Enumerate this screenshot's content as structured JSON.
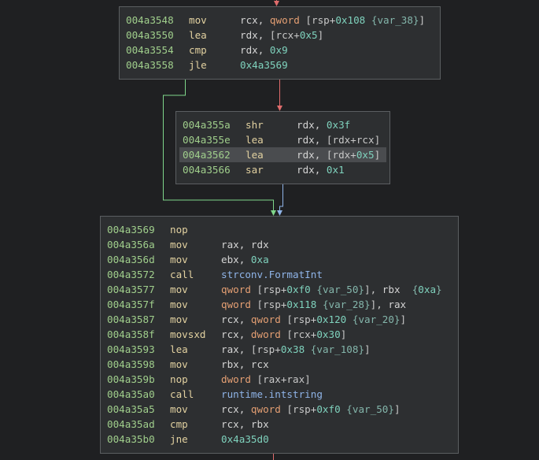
{
  "colors": {
    "background": "#1f2022",
    "block_bg": "#2d2f31",
    "block_border": "#5b5e61",
    "address": "#a0cf8c",
    "mnemonic": "#e2d1a0",
    "keyword": "#e49f73",
    "number": "#7fd2bd",
    "variable": "#84b6ab",
    "symbol": "#8fb4e8",
    "edge_true": "#7fd68a",
    "edge_false": "#e06c6c",
    "edge_unconditional": "#8fb4e8"
  },
  "blocks": [
    {
      "id": "block-004a3548",
      "lines": [
        {
          "addr": "004a3548",
          "mn": "mov",
          "ops": [
            [
              "reg",
              "rcx, "
            ],
            [
              "kw",
              "qword "
            ],
            [
              "punct",
              "[rsp+"
            ],
            [
              "num",
              "0x108"
            ],
            [
              "punct",
              " "
            ],
            [
              "var",
              "{var_38}"
            ],
            [
              "punct",
              "]"
            ]
          ]
        },
        {
          "addr": "004a3550",
          "mn": "lea",
          "ops": [
            [
              "reg",
              "rdx, "
            ],
            [
              "punct",
              "[rcx+"
            ],
            [
              "num",
              "0x5"
            ],
            [
              "punct",
              "]"
            ]
          ]
        },
        {
          "addr": "004a3554",
          "mn": "cmp",
          "ops": [
            [
              "reg",
              "rdx, "
            ],
            [
              "num",
              "0x9"
            ]
          ]
        },
        {
          "addr": "004a3558",
          "mn": "jle",
          "ops": [
            [
              "num",
              "0x4a3569"
            ]
          ]
        }
      ]
    },
    {
      "id": "block-004a355a",
      "lines": [
        {
          "addr": "004a355a",
          "mn": "shr",
          "ops": [
            [
              "reg",
              "rdx, "
            ],
            [
              "num",
              "0x3f"
            ]
          ]
        },
        {
          "addr": "004a355e",
          "mn": "lea",
          "ops": [
            [
              "reg",
              "rdx, "
            ],
            [
              "punct",
              "[rdx+rcx]"
            ]
          ]
        },
        {
          "addr": "004a3562",
          "mn": "lea",
          "ops": [
            [
              "reg",
              "rdx, "
            ],
            [
              "punct",
              "[rdx+"
            ],
            [
              "num",
              "0x5"
            ],
            [
              "punct",
              "]"
            ]
          ],
          "selected": true
        },
        {
          "addr": "004a3566",
          "mn": "sar",
          "ops": [
            [
              "reg",
              "rdx, "
            ],
            [
              "num",
              "0x1"
            ]
          ]
        }
      ]
    },
    {
      "id": "block-004a3569",
      "lines": [
        {
          "addr": "004a3569",
          "mn": "nop",
          "ops": []
        },
        {
          "addr": "004a356a",
          "mn": "mov",
          "ops": [
            [
              "reg",
              "rax, rdx"
            ]
          ]
        },
        {
          "addr": "004a356d",
          "mn": "mov",
          "ops": [
            [
              "reg",
              "ebx, "
            ],
            [
              "num",
              "0xa"
            ]
          ]
        },
        {
          "addr": "004a3572",
          "mn": "call",
          "ops": [
            [
              "sym",
              "strconv.FormatInt"
            ]
          ]
        },
        {
          "addr": "004a3577",
          "mn": "mov",
          "ops": [
            [
              "kw",
              "qword "
            ],
            [
              "punct",
              "[rsp+"
            ],
            [
              "num",
              "0xf0"
            ],
            [
              "punct",
              " "
            ],
            [
              "var",
              "{var_50}"
            ],
            [
              "punct",
              "], "
            ],
            [
              "reg",
              "rbx  "
            ],
            [
              "var",
              "{"
            ],
            [
              "num",
              "0xa"
            ],
            [
              "var",
              "}"
            ]
          ]
        },
        {
          "addr": "004a357f",
          "mn": "mov",
          "ops": [
            [
              "kw",
              "qword "
            ],
            [
              "punct",
              "[rsp+"
            ],
            [
              "num",
              "0x118"
            ],
            [
              "punct",
              " "
            ],
            [
              "var",
              "{var_28}"
            ],
            [
              "punct",
              "], "
            ],
            [
              "reg",
              "rax"
            ]
          ]
        },
        {
          "addr": "004a3587",
          "mn": "mov",
          "ops": [
            [
              "reg",
              "rcx, "
            ],
            [
              "kw",
              "qword "
            ],
            [
              "punct",
              "[rsp+"
            ],
            [
              "num",
              "0x120"
            ],
            [
              "punct",
              " "
            ],
            [
              "var",
              "{var_20}"
            ],
            [
              "punct",
              "]"
            ]
          ]
        },
        {
          "addr": "004a358f",
          "mn": "movsxd",
          "ops": [
            [
              "reg",
              "rcx, "
            ],
            [
              "kw",
              "dword "
            ],
            [
              "punct",
              "[rcx+"
            ],
            [
              "num",
              "0x30"
            ],
            [
              "punct",
              "]"
            ]
          ]
        },
        {
          "addr": "004a3593",
          "mn": "lea",
          "ops": [
            [
              "reg",
              "rax, "
            ],
            [
              "punct",
              "[rsp+"
            ],
            [
              "num",
              "0x38"
            ],
            [
              "punct",
              " "
            ],
            [
              "var",
              "{var_108}"
            ],
            [
              "punct",
              "]"
            ]
          ]
        },
        {
          "addr": "004a3598",
          "mn": "mov",
          "ops": [
            [
              "reg",
              "rbx, rcx"
            ]
          ]
        },
        {
          "addr": "004a359b",
          "mn": "nop",
          "ops": [
            [
              "kw",
              "dword "
            ],
            [
              "punct",
              "[rax+rax]"
            ]
          ]
        },
        {
          "addr": "004a35a0",
          "mn": "call",
          "ops": [
            [
              "sym",
              "runtime.intstring"
            ]
          ]
        },
        {
          "addr": "004a35a5",
          "mn": "mov",
          "ops": [
            [
              "reg",
              "rcx, "
            ],
            [
              "kw",
              "qword "
            ],
            [
              "punct",
              "[rsp+"
            ],
            [
              "num",
              "0xf0"
            ],
            [
              "punct",
              " "
            ],
            [
              "var",
              "{var_50}"
            ],
            [
              "punct",
              "]"
            ]
          ]
        },
        {
          "addr": "004a35ad",
          "mn": "cmp",
          "ops": [
            [
              "reg",
              "rcx, rbx"
            ]
          ]
        },
        {
          "addr": "004a35b0",
          "mn": "jne",
          "ops": [
            [
              "num",
              "0x4a35d0"
            ]
          ]
        }
      ]
    }
  ]
}
